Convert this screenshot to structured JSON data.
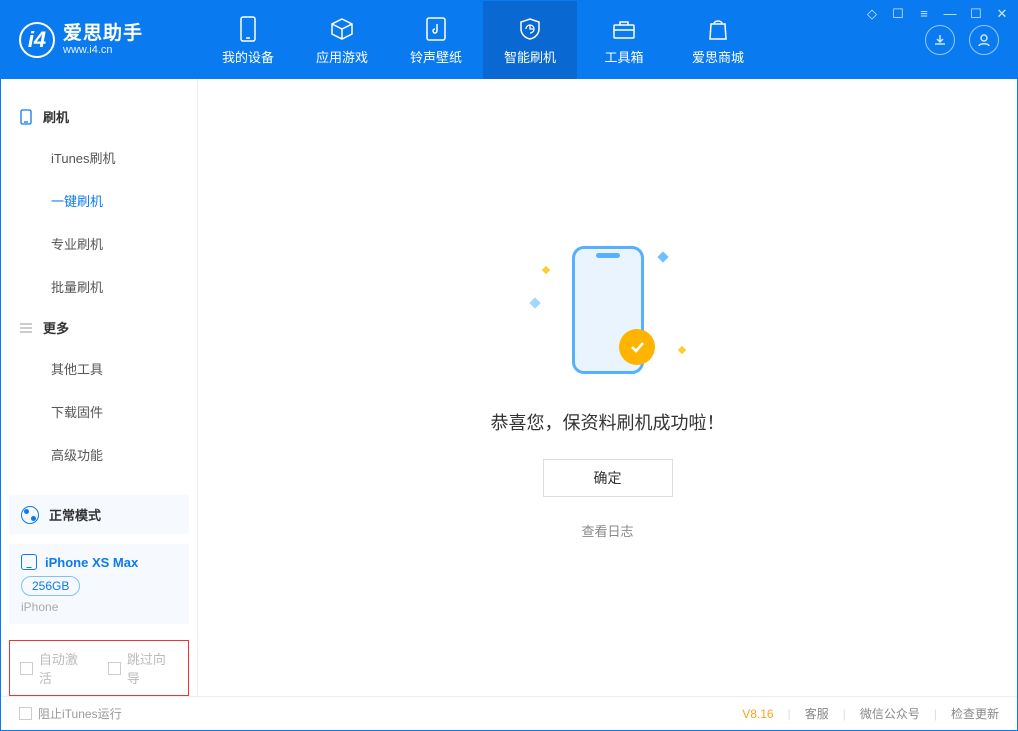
{
  "app": {
    "title": "爱思助手",
    "site": "www.i4.cn"
  },
  "nav": {
    "tabs": [
      {
        "label": "我的设备"
      },
      {
        "label": "应用游戏"
      },
      {
        "label": "铃声壁纸"
      },
      {
        "label": "智能刷机"
      },
      {
        "label": "工具箱"
      },
      {
        "label": "爱思商城"
      }
    ]
  },
  "sidebar": {
    "group1": {
      "title": "刷机",
      "items": [
        "iTunes刷机",
        "一键刷机",
        "专业刷机",
        "批量刷机"
      ]
    },
    "group2": {
      "title": "更多",
      "items": [
        "其他工具",
        "下载固件",
        "高级功能"
      ]
    },
    "mode": "正常模式",
    "device": {
      "name": "iPhone XS Max",
      "storage": "256GB",
      "type": "iPhone"
    },
    "checks": {
      "auto_activate": "自动激活",
      "skip_guide": "跳过向导"
    }
  },
  "main": {
    "success_msg": "恭喜您，保资料刷机成功啦！",
    "ok": "确定",
    "view_log": "查看日志"
  },
  "footer": {
    "block_itunes": "阻止iTunes运行",
    "version": "V8.16",
    "links": [
      "客服",
      "微信公众号",
      "检查更新"
    ]
  }
}
